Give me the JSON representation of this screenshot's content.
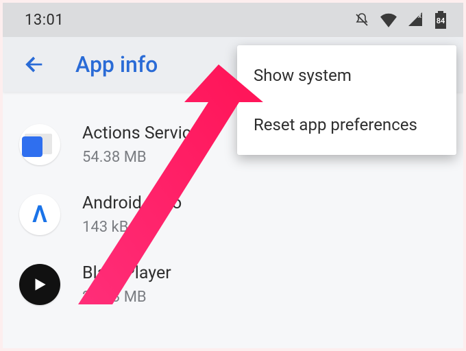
{
  "statusbar": {
    "clock": "13:01",
    "battery": "84"
  },
  "appbar": {
    "title": "App info"
  },
  "apps": [
    {
      "name": "Actions Services",
      "size": "54.38 MB",
      "icon": "actions-services-icon"
    },
    {
      "name": "Android Auto",
      "size": "143 kB",
      "icon": "android-auto-icon"
    },
    {
      "name": "BlackPlayer",
      "size": "24.93 MB",
      "icon": "blackplayer-icon"
    }
  ],
  "menu": {
    "items": [
      {
        "label": "Show system"
      },
      {
        "label": "Reset app preferences"
      }
    ]
  }
}
